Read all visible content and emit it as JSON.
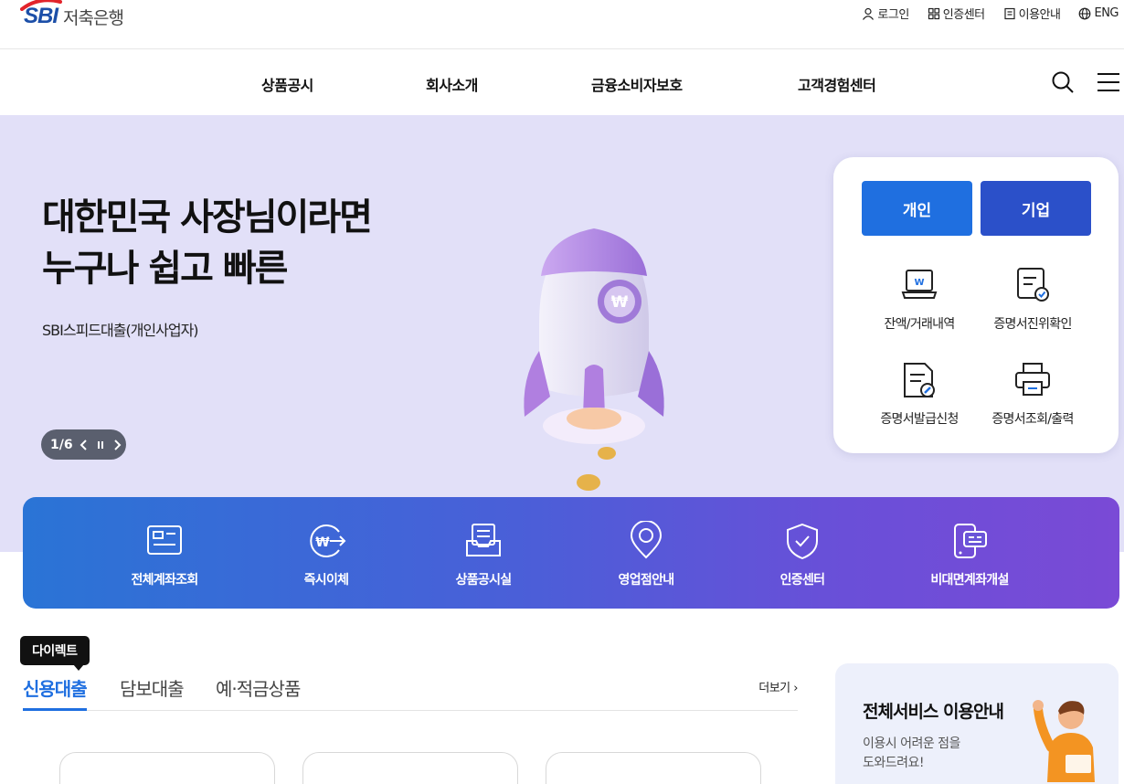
{
  "header": {
    "logo_brand": "SBI",
    "logo_text": "저축은행",
    "utility": [
      {
        "label": "로그인",
        "icon": "user-icon"
      },
      {
        "label": "인증센터",
        "icon": "grid-icon"
      },
      {
        "label": "이용안내",
        "icon": "document-icon"
      },
      {
        "label": "ENG",
        "icon": "globe-icon"
      }
    ]
  },
  "nav": {
    "items": [
      "상품공시",
      "회사소개",
      "금융소비자보호",
      "고객경험센터"
    ],
    "search_icon": "search-icon",
    "menu_icon": "hamburger-menu-icon"
  },
  "hero": {
    "title_line1": "대한민국 사장님이라면",
    "title_line2": "누구나 쉽고 빠른",
    "subtitle": "SBI스피드대출(개인사업자)",
    "pager": "1/6",
    "background_color": "#e2e0f8"
  },
  "quick_panel": {
    "personal_label": "개인",
    "company_label": "기업",
    "items": [
      {
        "label": "잔액/거래내역",
        "icon": "laptop-won-icon"
      },
      {
        "label": "증명서진위확인",
        "icon": "certificate-check-icon"
      },
      {
        "label": "증명서발급신청",
        "icon": "document-pen-icon"
      },
      {
        "label": "증명서조회/출력",
        "icon": "printer-icon"
      }
    ]
  },
  "services": [
    {
      "label": "전체계좌조회",
      "icon": "account-card-icon"
    },
    {
      "label": "즉시이체",
      "icon": "won-transfer-icon"
    },
    {
      "label": "상품공시실",
      "icon": "inbox-document-icon"
    },
    {
      "label": "영업점안내",
      "icon": "location-pin-icon"
    },
    {
      "label": "인증센터",
      "icon": "shield-check-icon"
    },
    {
      "label": "비대면계좌개설",
      "icon": "mobile-card-icon"
    }
  ],
  "products": {
    "tooltip": "다이렉트",
    "tabs": [
      "신용대출",
      "담보대출",
      "예·적금상품"
    ],
    "active_tab": 0,
    "more_label": "더보기"
  },
  "guide": {
    "title": "전체서비스 이용안내",
    "desc_line1": "이용시 어려운 점을",
    "desc_line2": "도와드려요!"
  },
  "colors": {
    "accent_blue": "#1f6fe0",
    "company_blue": "#2b50c9",
    "strip_start": "#2a74d6",
    "strip_end": "#7a4ad6"
  }
}
